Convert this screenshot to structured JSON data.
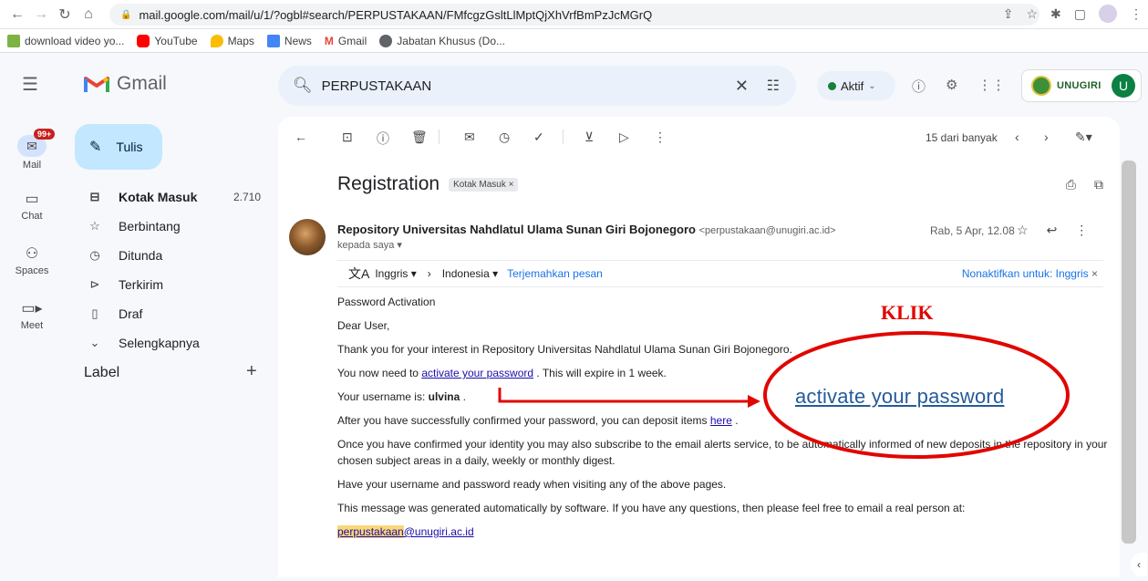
{
  "browser": {
    "url": "mail.google.com/mail/u/1/?ogbl#search/PERPUSTAKAAN/FMfcgzGsltLlMptQjXhVrfBmPzJcMGrQ",
    "bookmarks": [
      "download video yo...",
      "YouTube",
      "Maps",
      "News",
      "Gmail",
      "Jabatan Khusus (Do..."
    ]
  },
  "header": {
    "app_name": "Gmail",
    "search_value": "PERPUSTAKAAN",
    "status": "Aktif",
    "brand": "UNUGIRI",
    "avatar_letter": "U"
  },
  "rail": {
    "badge": "99+",
    "items": [
      "Mail",
      "Chat",
      "Spaces",
      "Meet"
    ]
  },
  "nav": {
    "compose": "Tulis",
    "items": [
      {
        "label": "Kotak Masuk",
        "count": "2.710"
      },
      {
        "label": "Berbintang"
      },
      {
        "label": "Ditunda"
      },
      {
        "label": "Terkirim"
      },
      {
        "label": "Draf"
      },
      {
        "label": "Selengkapnya"
      }
    ],
    "labels_heading": "Label"
  },
  "message": {
    "pager": "15 dari banyak",
    "subject": "Registration",
    "tag": "Kotak Masuk ×",
    "sender": "Repository Universitas Nahdlatul Ulama Sunan Giri Bojonegoro",
    "sender_email": "<perpustakaan@unugiri.ac.id>",
    "recipient": "kepada saya ▾",
    "date": "Rab, 5 Apr, 12.08",
    "translate": {
      "from": "Inggris ▾",
      "to": "Indonesia ▾",
      "action": "Terjemahkan pesan",
      "disable": "Nonaktifkan untuk: Inggris"
    },
    "body": {
      "heading": "Password Activation",
      "greeting": "Dear User,",
      "thanks": "Thank you for your interest in Repository Universitas Nahdlatul Ulama Sunan Giri Bojonegoro.",
      "activate_pre": "You now need to ",
      "activate_link": "activate your password",
      "activate_post": " . This will expire in 1 week.",
      "username_pre": "Your username is: ",
      "username": "ulvina",
      "username_post": " .",
      "deposit_pre": "After you have successfully confirmed your password, you can deposit items ",
      "deposit_link": "here",
      "deposit_post": " .",
      "subscribe_1": "Once you have confirmed your identity you may also subscribe to the email alerts service, to be automatically informed of new deposits in the repository in your",
      "subscribe_2": "chosen subject areas in a daily, weekly or monthly digest.",
      "ready": "Have your username and password ready when visiting any of the above pages.",
      "auto": "This message was generated automatically by software. If you have any questions, then please feel free to email a real person at:",
      "contact_hl": "perpustakaan",
      "contact_rest": "@unugiri.ac.id"
    }
  },
  "annotation": {
    "klik": "KLIK",
    "big_link": "activate your password",
    "color": "#e10600"
  }
}
